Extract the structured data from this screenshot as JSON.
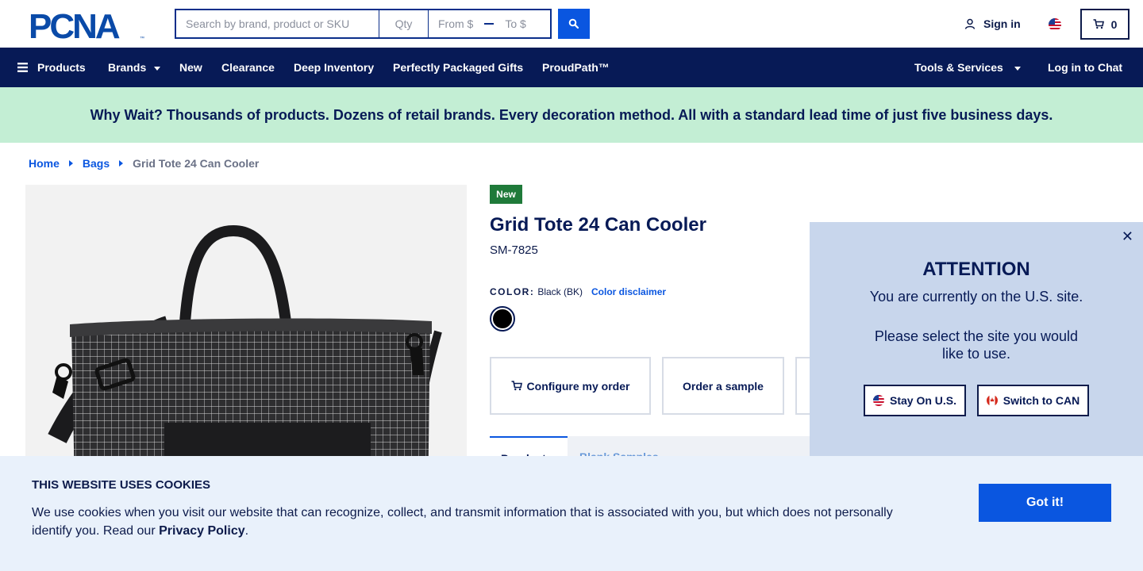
{
  "header": {
    "logo_text": "PCNA",
    "search": {
      "placeholder": "Search by brand, product or SKU",
      "qty_placeholder": "Qty",
      "from_placeholder": "From $",
      "to_placeholder": "To $"
    },
    "signin_label": "Sign in",
    "cart_count": "0"
  },
  "nav": {
    "items": [
      {
        "label": "Products"
      },
      {
        "label": "Brands"
      },
      {
        "label": "New"
      },
      {
        "label": "Clearance"
      },
      {
        "label": "Deep Inventory"
      },
      {
        "label": "Perfectly Packaged Gifts"
      },
      {
        "label": "ProudPath™"
      },
      {
        "label": "Tools & Services"
      },
      {
        "label": "Log in to Chat"
      }
    ]
  },
  "promo": {
    "text": "Why Wait? Thousands of products. Dozens of retail brands. Every decoration method. All with a standard lead time of just five business days."
  },
  "breadcrumb": {
    "items": [
      "Home",
      "Bags"
    ],
    "current": "Grid Tote 24 Can Cooler"
  },
  "product": {
    "badge": "New",
    "title": "Grid Tote 24 Can Cooler",
    "sku": "SM-7825",
    "color_label": "COLOR:",
    "color_value": "Black (BK)",
    "color_disclaimer": "Color disclaimer",
    "swatch_color": "#000000",
    "actions": {
      "configure": "Configure my order",
      "sample": "Order a sample"
    },
    "tabs": [
      "Pr  oduct",
      "Blank  Samples"
    ]
  },
  "region_modal": {
    "title": "ATTENTION",
    "message1": "You are currently on the U.S. site.",
    "message2": "Please select the site you would like to use.",
    "stay_label": "Stay On U.S.",
    "switch_label": "Switch to CAN"
  },
  "cookie": {
    "title": "THIS WEBSITE USES COOKIES",
    "text_before": "We use cookies when you visit our website that can recognize, collect, and transmit information that is associated with you, but which does not personally identify you. Read our ",
    "link": "Privacy Policy",
    "text_after": ".",
    "button": "Got it!"
  },
  "colors": {
    "navy": "#071a56",
    "brand_blue": "#0a56e0",
    "promo_green": "#c3eed4",
    "badge_green": "#1f7a3a"
  }
}
